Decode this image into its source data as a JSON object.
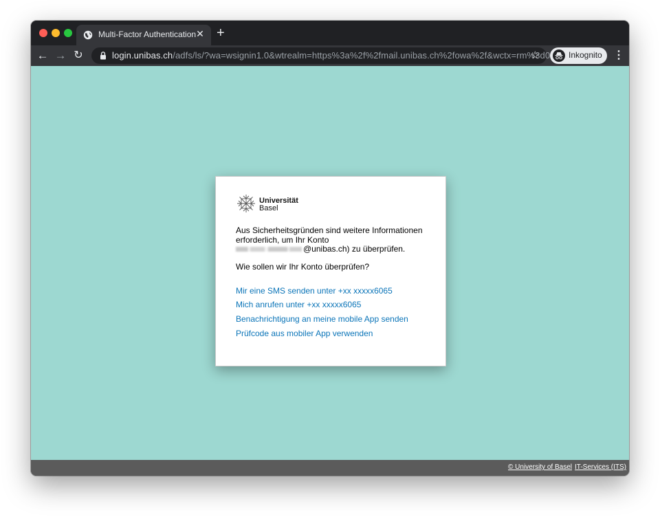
{
  "browser": {
    "tab_title": "Multi-Factor Authentication",
    "url_host": "login.unibas.ch",
    "url_path": "/adfs/ls/?wa=wsignin1.0&wtrealm=https%3a%2f%2fmail.unibas.ch%2fowa%2f&wctx=rm%3d0...",
    "incognito_label": "Inkognito"
  },
  "dialog": {
    "logo_line1": "Universität",
    "logo_line2": "Basel",
    "intro": "Aus Sicherheitsgründen sind weitere Informationen erforderlich, um Ihr Konto",
    "email_suffix": "@unibas.ch) zu überprüfen.",
    "question": "Wie sollen wir Ihr Konto überprüfen?",
    "options": [
      "Mir eine SMS senden unter +xx xxxxx6065",
      "Mich anrufen unter +xx xxxxx6065",
      "Benachrichtigung an meine mobile App senden",
      "Prüfcode aus mobiler App verwenden"
    ]
  },
  "footer": {
    "copyright_link": "© University of Basel",
    "its_link": "IT-Services (ITS)"
  },
  "colors": {
    "page_background": "#9dd8d1",
    "link": "#0a74b8",
    "footer": "#5b5b5b"
  },
  "icons": [
    "globe-icon",
    "close-icon",
    "plus-icon",
    "back-arrow-icon",
    "forward-arrow-icon",
    "reload-icon",
    "lock-icon",
    "star-icon",
    "incognito-icon",
    "kebab-menu-icon"
  ]
}
